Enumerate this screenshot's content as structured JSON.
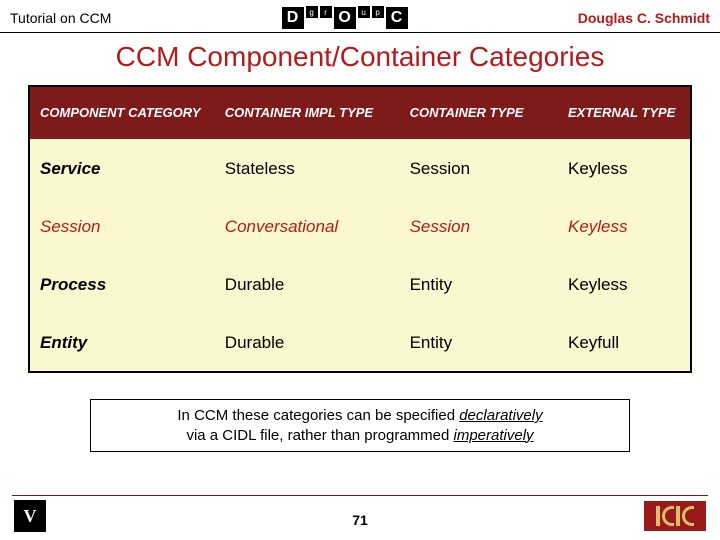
{
  "header": {
    "left": "Tutorial on CCM",
    "right": "Douglas C. Schmidt",
    "logo": {
      "d": "D",
      "g": "g",
      "r": "r",
      "o": "O",
      "u": "u",
      "p": "p",
      "c": "C"
    }
  },
  "title": "CCM Component/Container Categories",
  "table": {
    "headers": {
      "c1": "COMPONENT CATEGORY",
      "c2": "CONTAINER IMPL TYPE",
      "c3": "CONTAINER TYPE",
      "c4": "EXTERNAL TYPE"
    },
    "rows": [
      {
        "c1": "Service",
        "c2": "Stateless",
        "c3": "Session",
        "c4": "Keyless",
        "style": "bold"
      },
      {
        "c1": "Session",
        "c2": "Conversational",
        "c3": "Session",
        "c4": "Keyless",
        "style": "red"
      },
      {
        "c1": "Process",
        "c2": "Durable",
        "c3": "Entity",
        "c4": "Keyless",
        "style": "bold"
      },
      {
        "c1": "Entity",
        "c2": "Durable",
        "c3": "Entity",
        "c4": "Keyfull",
        "style": "bold"
      }
    ]
  },
  "note": {
    "pre": "In CCM these categories can be specified ",
    "decl": "declaratively",
    "mid": " via a CIDL file, rather than programmed ",
    "imp": "imperatively"
  },
  "page": "71"
}
